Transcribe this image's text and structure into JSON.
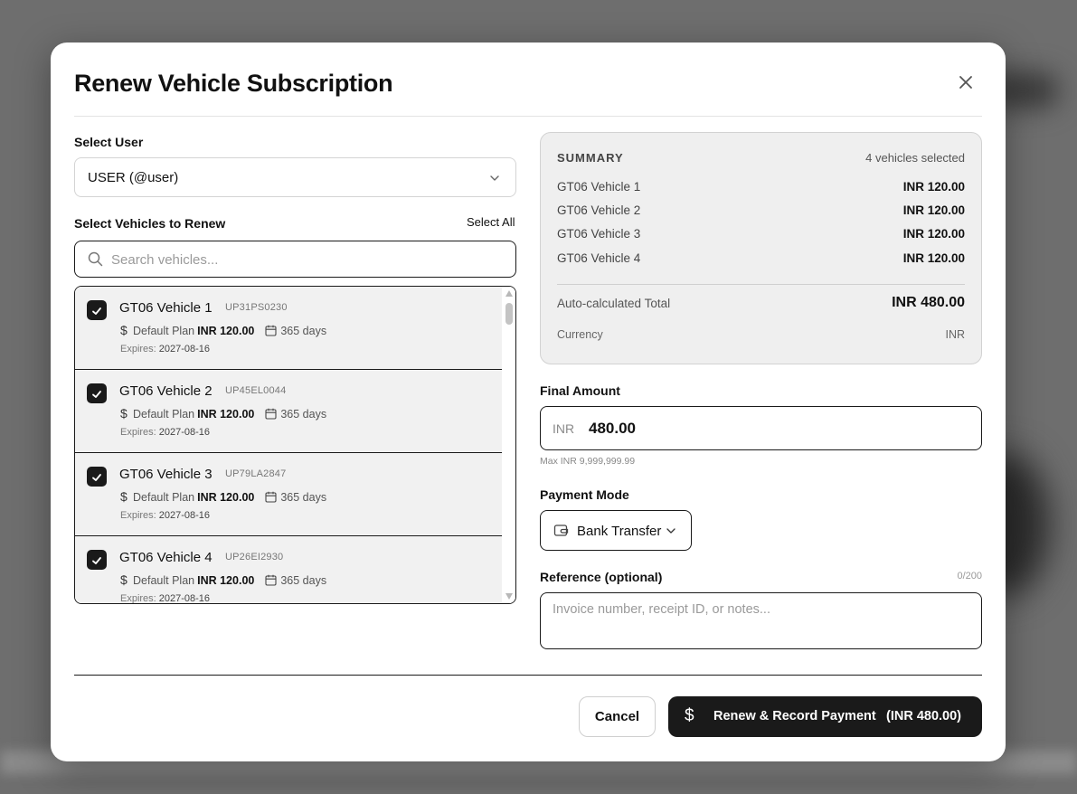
{
  "modal": {
    "title": "Renew Vehicle Subscription",
    "close_icon": "close-icon"
  },
  "user_select": {
    "label": "Select User",
    "value": "USER (@user)"
  },
  "vehicles_section": {
    "label": "Select Vehicles to Renew",
    "select_all": "Select All",
    "search_placeholder": "Search vehicles...",
    "items": [
      {
        "name": "GT06 Vehicle 1",
        "plate": "UP31PS0230",
        "plan": "Default Plan",
        "price": "INR 120.00",
        "duration": "365 days",
        "expires_label": "Expires:",
        "expires": "2027-08-16",
        "checked": true
      },
      {
        "name": "GT06 Vehicle 2",
        "plate": "UP45EL0044",
        "plan": "Default Plan",
        "price": "INR 120.00",
        "duration": "365 days",
        "expires_label": "Expires:",
        "expires": "2027-08-16",
        "checked": true
      },
      {
        "name": "GT06 Vehicle 3",
        "plate": "UP79LA2847",
        "plan": "Default Plan",
        "price": "INR 120.00",
        "duration": "365 days",
        "expires_label": "Expires:",
        "expires": "2027-08-16",
        "checked": true
      },
      {
        "name": "GT06 Vehicle 4",
        "plate": "UP26EI2930",
        "plan": "Default Plan",
        "price": "INR 120.00",
        "duration": "365 days",
        "expires_label": "Expires:",
        "expires": "2027-08-16",
        "checked": true
      }
    ]
  },
  "summary": {
    "title": "SUMMARY",
    "count": "4 vehicles selected",
    "rows": [
      {
        "name": "GT06 Vehicle 1",
        "amount": "INR 120.00"
      },
      {
        "name": "GT06 Vehicle 2",
        "amount": "INR 120.00"
      },
      {
        "name": "GT06 Vehicle 3",
        "amount": "INR 120.00"
      },
      {
        "name": "GT06 Vehicle 4",
        "amount": "INR 120.00"
      }
    ],
    "total_label": "Auto-calculated Total",
    "total": "INR 480.00",
    "currency_label": "Currency",
    "currency": "INR"
  },
  "final_amount": {
    "label": "Final Amount",
    "currency": "INR",
    "value": "480.00",
    "max_note": "Max INR 9,999,999.99"
  },
  "payment_mode": {
    "label": "Payment Mode",
    "value": "Bank Transfer"
  },
  "reference": {
    "label": "Reference (optional)",
    "count": "0/200",
    "placeholder": "Invoice number, receipt ID, or notes..."
  },
  "footer": {
    "cancel": "Cancel",
    "primary_label": "Renew & Record Payment",
    "primary_total": "(INR 480.00)",
    "primary_icon": "$"
  },
  "colors": {
    "primary": "#1a1a1a",
    "summary_bg": "#efefef",
    "overlay": "#6e6e6e"
  }
}
